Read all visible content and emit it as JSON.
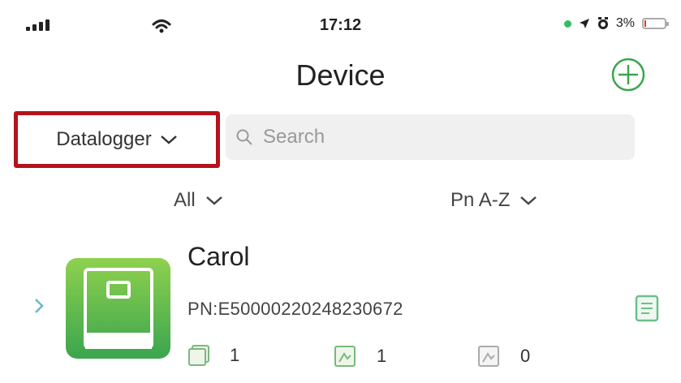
{
  "status_bar": {
    "time": "17:12",
    "battery": "3%"
  },
  "header": {
    "title": "Device"
  },
  "filter": {
    "type_label": "Datalogger",
    "search_placeholder": "Search",
    "search_value": ""
  },
  "sort": {
    "status_label": "All",
    "order_label": "Pn A-Z"
  },
  "device": {
    "name": "Carol",
    "pn": "PN:E50000220248230672",
    "stats": [
      "1",
      "1",
      "0"
    ]
  },
  "colors": {
    "accent": "#3aa54d",
    "highlight_border": "#b5121b",
    "online_dot": "#31c15a"
  }
}
